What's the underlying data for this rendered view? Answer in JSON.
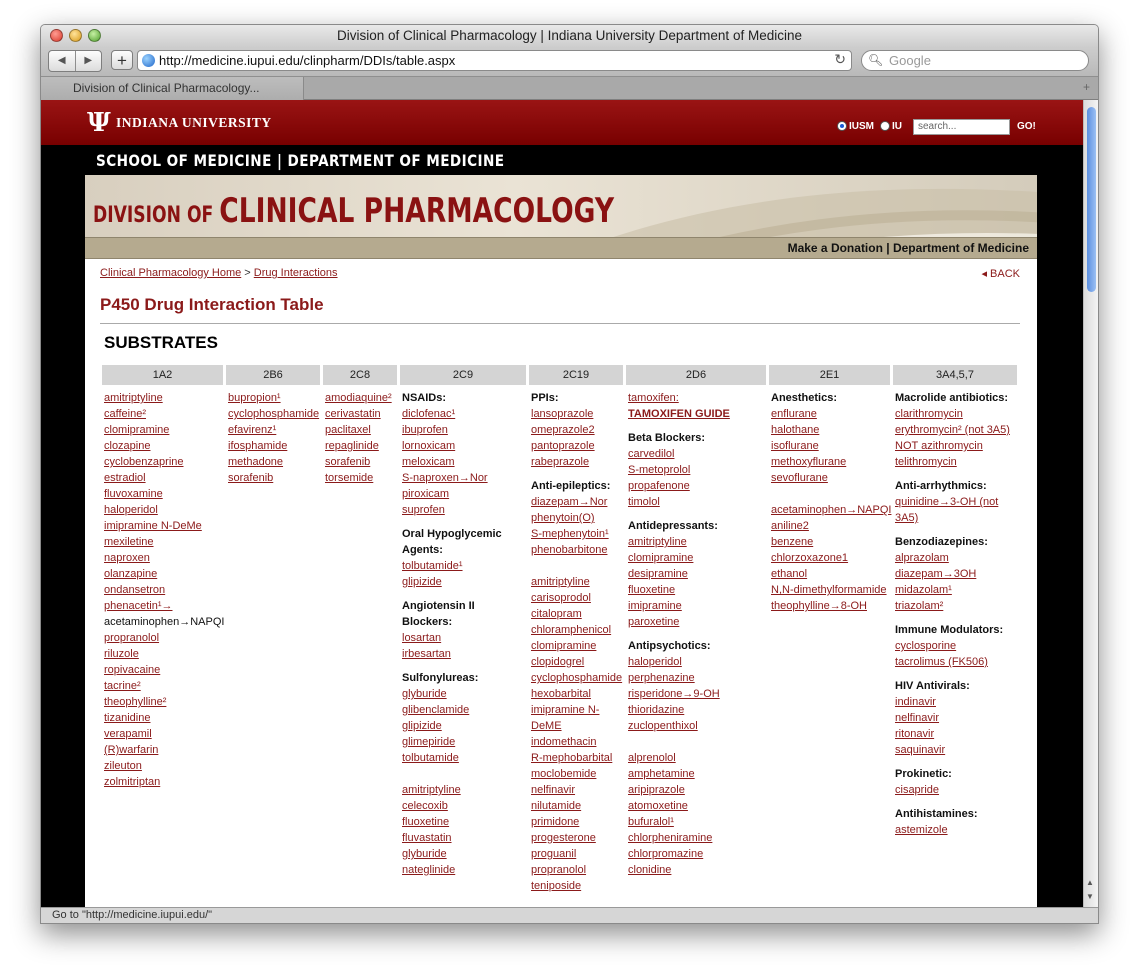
{
  "window": {
    "title": "Division of Clinical Pharmacology | Indiana University Department of Medicine"
  },
  "toolbar": {
    "back": "◀",
    "forward": "▶",
    "add": "+",
    "url": "http://medicine.iupui.edu/clinpharm/DDIs/table.aspx",
    "reload": "↻",
    "search_placeholder": "Google"
  },
  "tab": {
    "label": "Division of Clinical Pharmacology..."
  },
  "iu": {
    "name": "INDIANA UNIVERSITY",
    "radio1": "IUSM",
    "radio2": "IU",
    "search_placeholder": "search...",
    "go": "GO!"
  },
  "school": "SCHOOL OF MEDICINE  |  DEPARTMENT OF MEDICINE",
  "banner": {
    "prefix": "DIVISION OF ",
    "main": "CLINICAL PHARMACOLOGY"
  },
  "linkbar": {
    "donation": "Make a Donation",
    "sep": " | ",
    "department": "Department of Medicine"
  },
  "breadcrumb": {
    "home": "Clinical Pharmacology Home",
    "sep": " > ",
    "current": "Drug Interactions",
    "back": "BACK"
  },
  "page": {
    "title": "P450 Drug Interaction Table",
    "section": "SUBSTRATES"
  },
  "columns": [
    "1A2",
    "2B6",
    "2C8",
    "2C9",
    "2C19",
    "2D6",
    "2E1",
    "3A4,5,7"
  ],
  "col_1A2": [
    "amitriptyline",
    "caffeine²",
    "clomipramine",
    "clozapine",
    "cyclobenzaprine",
    "estradiol",
    "fluvoxamine",
    "haloperidol",
    "imipramine N-DeMe",
    "mexiletine",
    "naproxen",
    "olanzapine",
    "ondansetron",
    "phenacetin¹→",
    "acetaminophen→NAPQI",
    "propranolol",
    "riluzole",
    "ropivacaine",
    "tacrine²",
    "theophylline²",
    "tizanidine",
    "verapamil",
    "(R)warfarin",
    "zileuton",
    "zolmitriptan"
  ],
  "col_2B6": [
    "bupropion¹",
    "cyclophosphamide",
    "efavirenz¹",
    "ifosphamide",
    "methadone",
    "sorafenib"
  ],
  "col_2C8": [
    "amodiaquine²",
    "cerivastatin",
    "paclitaxel",
    "repaglinide",
    "sorafenib",
    "torsemide"
  ],
  "col_2C9": {
    "nsaids_h": "NSAIDs:",
    "nsaids": [
      "diclofenac¹",
      "ibuprofen",
      "lornoxicam",
      "meloxicam",
      "S-naproxen→Nor",
      "piroxicam",
      "suprofen"
    ],
    "oral_h": "Oral Hypoglycemic Agents:",
    "oral": [
      "tolbutamide¹",
      "glipizide"
    ],
    "ang_h": "Angiotensin II Blockers:",
    "ang": [
      "losartan",
      "irbesartan"
    ],
    "sulf_h": "Sulfonylureas:",
    "sulf": [
      "glyburide",
      "glibenclamide",
      "glipizide",
      "glimepiride",
      "tolbutamide"
    ],
    "other": [
      "amitriptyline",
      "celecoxib",
      "fluoxetine",
      "fluvastatin",
      "glyburide",
      "nateglinide"
    ]
  },
  "col_2C19": {
    "ppis_h": "PPIs:",
    "ppis": [
      "lansoprazole",
      "omeprazole2",
      "pantoprazole",
      "rabeprazole"
    ],
    "anti_h": "Anti-epileptics:",
    "anti": [
      "diazepam→Nor",
      "phenytoin(O)",
      "S-mephenytoin¹",
      "phenobarbitone"
    ],
    "other": [
      "amitriptyline",
      "carisoprodol",
      "citalopram",
      "chloramphenicol",
      "clomipramine",
      "clopidogrel",
      "cyclophosphamide",
      "hexobarbital",
      "imipramine N-DeME",
      "indomethacin",
      "R-mephobarbital",
      "moclobemide",
      "nelfinavir",
      "nilutamide",
      "primidone",
      "progesterone",
      "proguanil",
      "propranolol",
      "teniposide"
    ]
  },
  "col_2D6": {
    "tam": "tamoxifen:",
    "tam_guide": "TAMOXIFEN GUIDE",
    "beta_h": "Beta Blockers:",
    "beta": [
      "carvedilol",
      "S-metoprolol",
      "propafenone",
      "timolol"
    ],
    "antid_h": "Antidepressants:",
    "antid": [
      "amitriptyline",
      "clomipramine",
      "desipramine",
      "fluoxetine",
      "imipramine",
      "paroxetine"
    ],
    "antip_h": "Antipsychotics:",
    "antip": [
      "haloperidol",
      "perphenazine",
      "risperidone→9-OH",
      "thioridazine",
      "zuclopenthixol"
    ],
    "other": [
      "alprenolol",
      "amphetamine",
      "aripiprazole",
      "atomoxetine",
      "bufuralol¹",
      "chlorpheniramine",
      "chlorpromazine",
      "clonidine"
    ]
  },
  "col_2E1": {
    "anes_h": "Anesthetics:",
    "anes": [
      "enflurane",
      "halothane",
      "isoflurane",
      "methoxyflurane",
      "sevoflurane"
    ],
    "other": [
      "acetaminophen→NAPQI",
      "aniline2",
      "benzene",
      "chlorzoxazone1",
      "ethanol",
      "N,N-dimethylformamide",
      "theophylline→8-OH"
    ]
  },
  "col_3A4": {
    "mac_h": "Macrolide antibiotics:",
    "mac": [
      "clarithromycin",
      "erythromycin² (not 3A5)",
      "NOT azithromycin",
      "telithromycin"
    ],
    "arr_h": "Anti-arrhythmics:",
    "arr": [
      "quinidine→3-OH (not 3A5)"
    ],
    "benzo_h": "Benzodiazepines:",
    "benzo": [
      "alprazolam",
      "diazepam→3OH",
      "midazolam¹",
      "triazolam²"
    ],
    "imm_h": "Immune Modulators:",
    "imm": [
      "cyclosporine",
      "tacrolimus (FK506)"
    ],
    "hiv_h": "HIV Antivirals:",
    "hiv": [
      "indinavir",
      "nelfinavir",
      "ritonavir",
      "saquinavir"
    ],
    "pro_h": "Prokinetic:",
    "pro": [
      "cisapride"
    ],
    "ah_h": "Antihistamines:",
    "ah": [
      "astemizole"
    ]
  },
  "status": "Go to \"http://medicine.iupui.edu/\""
}
